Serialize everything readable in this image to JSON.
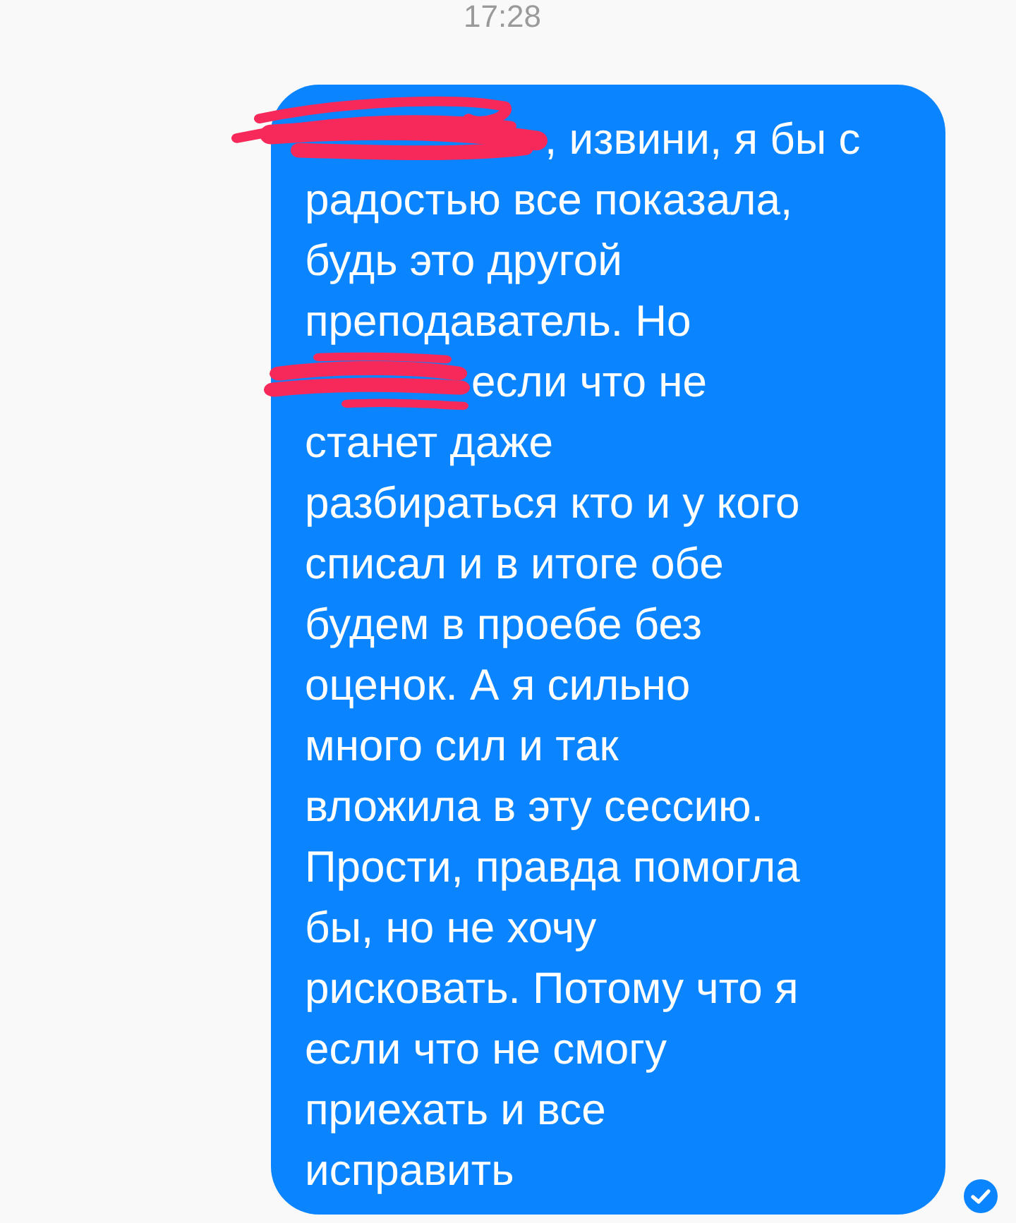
{
  "timestamp": "17:28",
  "message": {
    "segments": [
      {
        "redacted_before": true,
        "lines": [
          ", извини, я бы с"
        ]
      },
      {
        "redacted_before": false,
        "lines": [
          "радостью все показала,",
          "будь это другой",
          "преподаватель. Но"
        ]
      },
      {
        "redacted_before": true,
        "lines": [
          "если что не"
        ]
      },
      {
        "redacted_before": false,
        "lines": [
          "станет даже",
          "разбираться кто и у кого",
          "списал и в итоге обе",
          "будем в проебе без",
          "оценок. А я сильно",
          "много сил и так",
          "вложила в эту сессию.",
          "Прости, правда помогла",
          "бы, но не хочу",
          "рисковать. Потому что я",
          "если что не смогу",
          "приехать и все",
          "исправить"
        ]
      }
    ]
  }
}
